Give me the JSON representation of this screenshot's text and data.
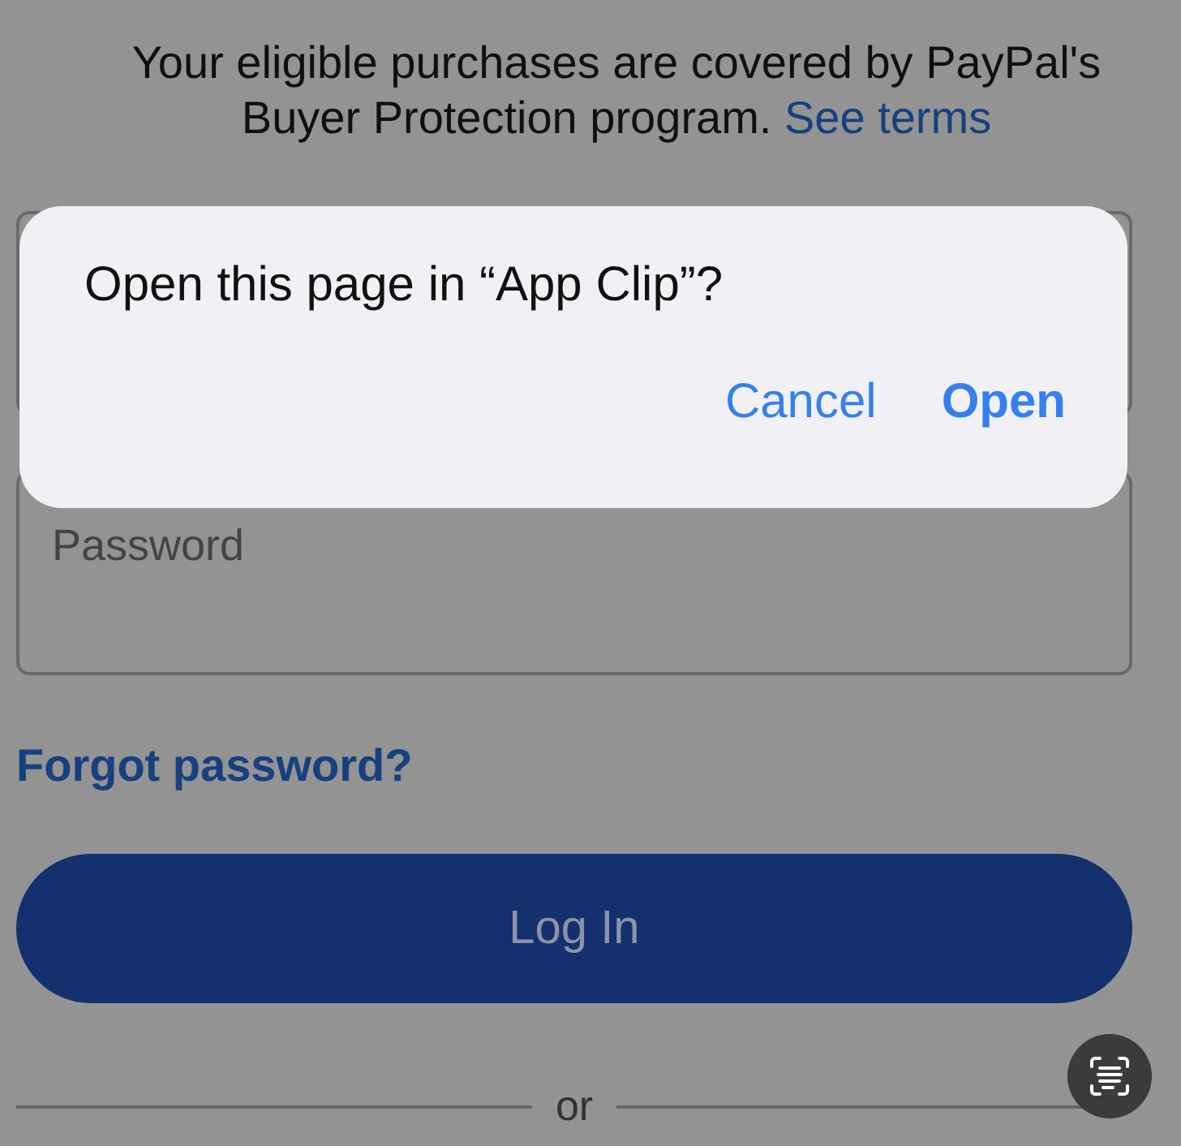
{
  "protection_notice": {
    "text": "Your eligible purchases are covered by PayPal's Buyer Protection program.",
    "link": "See terms"
  },
  "password_field": {
    "placeholder": "Password"
  },
  "forgot_link": "Forgot password?",
  "login_button": "Log In",
  "divider": "or",
  "dialog": {
    "message": "Open this page in “App Clip”?",
    "actions": [
      {
        "label": "Cancel",
        "kind": "cancel"
      },
      {
        "label": "Open",
        "kind": "default"
      }
    ]
  }
}
